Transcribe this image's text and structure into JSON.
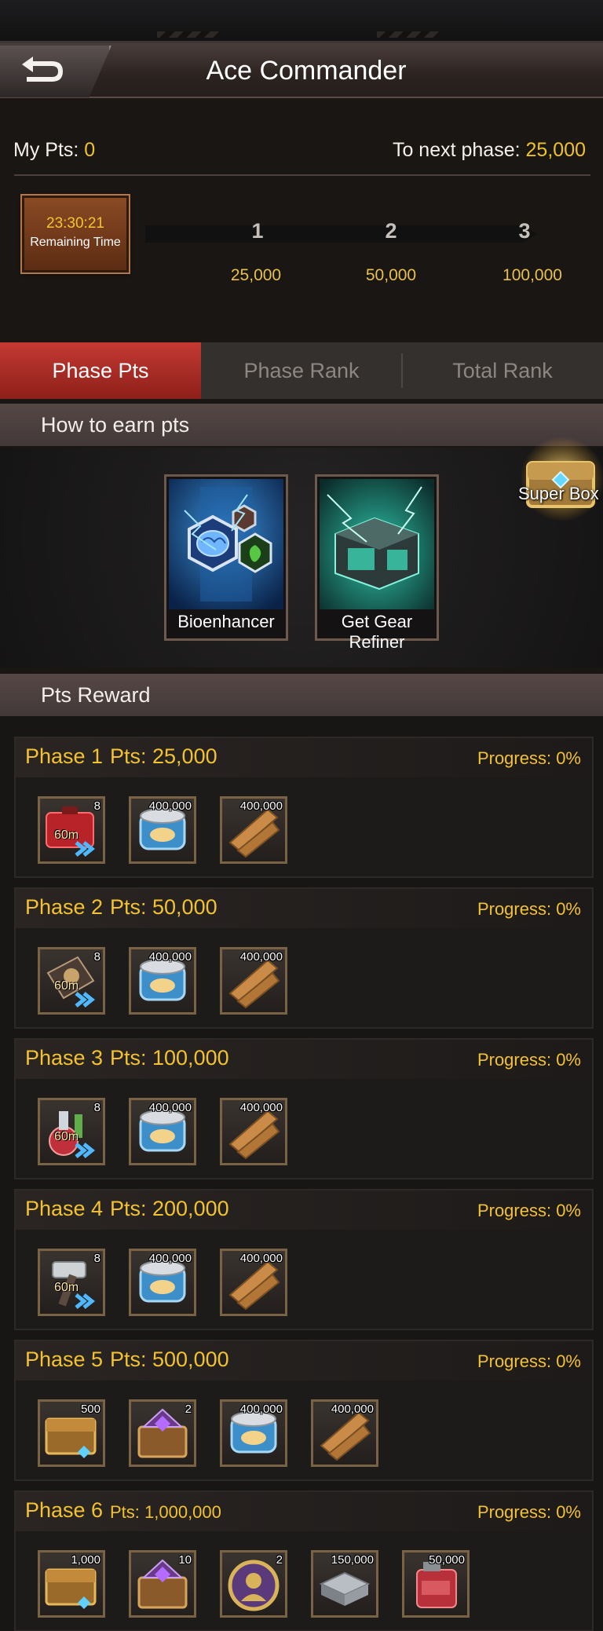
{
  "header": {
    "title": "Ace Commander"
  },
  "points": {
    "my_pts_label": "My Pts:",
    "my_pts_value": "0",
    "next_label": "To next phase:",
    "next_value": "25,000"
  },
  "timer": {
    "time": "23:30:21",
    "label": "Remaining Time"
  },
  "milestones": [
    {
      "num": "1",
      "value": "25,000"
    },
    {
      "num": "2",
      "value": "50,000"
    },
    {
      "num": "3",
      "value": "100,000"
    }
  ],
  "tabs": [
    "Phase Pts",
    "Phase Rank",
    "Total Rank"
  ],
  "earn": {
    "title": "How to earn pts",
    "cards": [
      "Bioenhancer",
      "Get Gear Refiner"
    ]
  },
  "super_box": {
    "label": "Super Box"
  },
  "rewards_title": "Pts Reward",
  "phases": [
    {
      "name": "Phase 1",
      "pts": "Pts: 25,000",
      "progress": "Progress: 0%",
      "items": [
        {
          "icon": "red-case-speedup-icon",
          "count": "8",
          "time": "60m"
        },
        {
          "icon": "food-can-icon",
          "count": "400,000"
        },
        {
          "icon": "wood-planks-icon",
          "count": "400,000"
        }
      ]
    },
    {
      "name": "Phase 2",
      "pts": "Pts: 50,000",
      "progress": "Progress: 0%",
      "items": [
        {
          "icon": "training-speedup-icon",
          "count": "8",
          "time": "60m"
        },
        {
          "icon": "food-can-icon",
          "count": "400,000"
        },
        {
          "icon": "wood-planks-icon",
          "count": "400,000"
        }
      ]
    },
    {
      "name": "Phase 3",
      "pts": "Pts: 100,000",
      "progress": "Progress: 0%",
      "items": [
        {
          "icon": "research-flask-speedup-icon",
          "count": "8",
          "time": "60m"
        },
        {
          "icon": "food-can-icon",
          "count": "400,000"
        },
        {
          "icon": "wood-planks-icon",
          "count": "400,000"
        }
      ]
    },
    {
      "name": "Phase 4",
      "pts": "Pts: 200,000",
      "progress": "Progress: 0%",
      "items": [
        {
          "icon": "hammer-speedup-icon",
          "count": "8",
          "time": "60m"
        },
        {
          "icon": "food-can-icon",
          "count": "400,000"
        },
        {
          "icon": "wood-planks-icon",
          "count": "400,000"
        }
      ]
    },
    {
      "name": "Phase 5",
      "pts": "Pts: 500,000",
      "progress": "Progress: 0%",
      "items": [
        {
          "icon": "gold-chest-icon",
          "count": "500"
        },
        {
          "icon": "purple-gem-chest-icon",
          "count": "2"
        },
        {
          "icon": "food-can-icon",
          "count": "400,000"
        },
        {
          "icon": "wood-planks-icon",
          "count": "400,000"
        }
      ]
    },
    {
      "name": "Phase 6",
      "pts": "Pts: 1,000,000",
      "progress": "Progress: 0%",
      "items": [
        {
          "icon": "gold-chest-icon",
          "count": "1,000"
        },
        {
          "icon": "purple-gem-chest-icon",
          "count": "10"
        },
        {
          "icon": "commander-medal-icon",
          "count": "2"
        },
        {
          "icon": "steel-ingot-icon",
          "count": "150,000"
        },
        {
          "icon": "fuel-canister-icon",
          "count": "50,000"
        }
      ]
    }
  ],
  "colors": {
    "gold_text": "#f2c230",
    "active_tab": "#b2302a",
    "timer_bg": "#7a4020"
  }
}
